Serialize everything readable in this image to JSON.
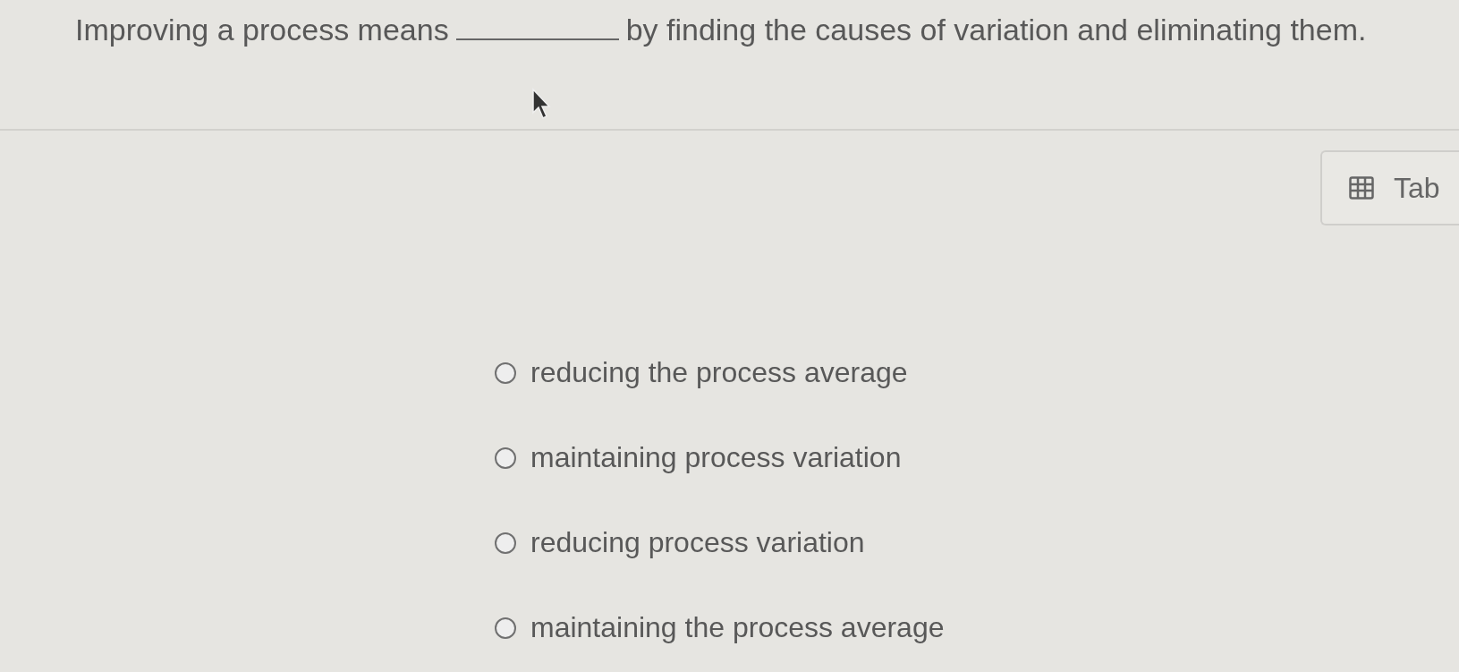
{
  "question": {
    "before": "Improving a process means",
    "after": "by finding the causes of variation and eliminating them."
  },
  "table_button": {
    "label": "Tab"
  },
  "options": [
    {
      "label": "reducing the process average",
      "selected": false
    },
    {
      "label": "maintaining process variation",
      "selected": false
    },
    {
      "label": "reducing process variation",
      "selected": false
    },
    {
      "label": "maintaining the process average",
      "selected": false
    }
  ]
}
